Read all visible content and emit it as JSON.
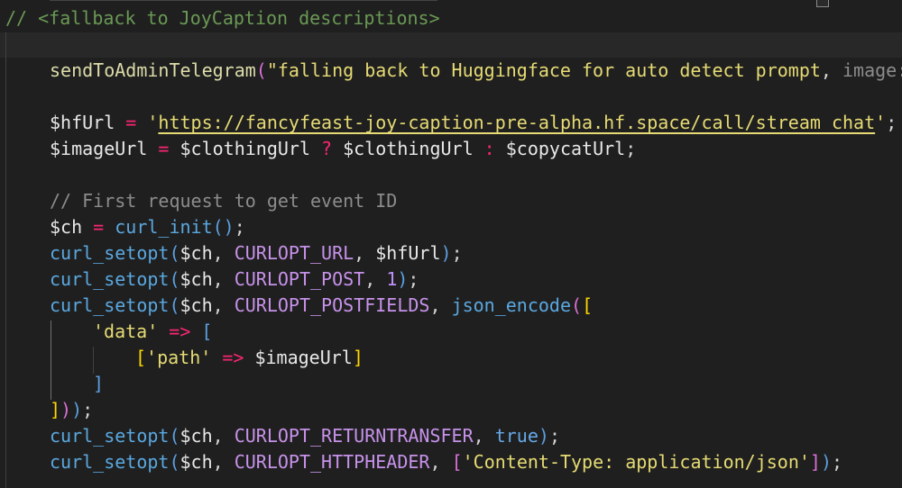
{
  "editor": {
    "language": "php",
    "theme_colors": {
      "background": "#1f1f1f",
      "current_line": "#282828",
      "comment": "#6a9955",
      "function": "#dcdcaa",
      "string": "#e6db74",
      "variable": "#e8e8e8",
      "operator": "#f92672",
      "constant": "#c792ea"
    },
    "lines": [
      {
        "tokens": [
          {
            "t": "// <fallback to JoyCaption descriptions>",
            "c": "c-com"
          }
        ]
      },
      {
        "tokens": []
      },
      {
        "tokens": [
          {
            "t": "sendToAdminTelegram",
            "c": "c-fn"
          },
          {
            "t": "(",
            "c": "c-b2"
          },
          {
            "t": "\"falling back to Huggingface for auto detect prompt",
            "c": "c-str2"
          },
          {
            "t": ", ",
            "c": "c-pun"
          },
          {
            "t": "image: ",
            "c": "c-hint"
          },
          {
            "t": "\"",
            "c": "c-str2"
          }
        ]
      },
      {
        "tokens": []
      },
      {
        "tokens": [
          {
            "t": "$hfUrl",
            "c": "c-var"
          },
          {
            "t": " = ",
            "c": "c-op"
          },
          {
            "t": "'",
            "c": "c-str2"
          },
          {
            "t": "https://fancyfeast-joy-caption-pre-alpha.hf.space/call/stream_chat",
            "c": "c-url"
          },
          {
            "t": "'",
            "c": "c-str2"
          },
          {
            "t": ";",
            "c": "c-pun"
          }
        ]
      },
      {
        "tokens": [
          {
            "t": "$imageUrl",
            "c": "c-var"
          },
          {
            "t": " = ",
            "c": "c-op"
          },
          {
            "t": "$clothingUrl",
            "c": "c-var"
          },
          {
            "t": " ? ",
            "c": "c-op"
          },
          {
            "t": "$clothingUrl",
            "c": "c-var"
          },
          {
            "t": " : ",
            "c": "c-op"
          },
          {
            "t": "$copycatUrl",
            "c": "c-var"
          },
          {
            "t": ";",
            "c": "c-pun"
          }
        ]
      },
      {
        "tokens": []
      },
      {
        "tokens": [
          {
            "t": "// First request to get event ID",
            "c": "c-hint"
          }
        ]
      },
      {
        "tokens": [
          {
            "t": "$ch",
            "c": "c-var"
          },
          {
            "t": " = ",
            "c": "c-op"
          },
          {
            "t": "curl_init",
            "c": "c-fn3"
          },
          {
            "t": "()",
            "c": "c-b1"
          },
          {
            "t": ";",
            "c": "c-pun"
          }
        ]
      },
      {
        "tokens": [
          {
            "t": "curl_setopt",
            "c": "c-fn3"
          },
          {
            "t": "(",
            "c": "c-b1"
          },
          {
            "t": "$ch",
            "c": "c-var"
          },
          {
            "t": ", ",
            "c": "c-pun"
          },
          {
            "t": "CURLOPT_URL",
            "c": "c-const"
          },
          {
            "t": ", ",
            "c": "c-pun"
          },
          {
            "t": "$hfUrl",
            "c": "c-var"
          },
          {
            "t": ")",
            "c": "c-b1"
          },
          {
            "t": ";",
            "c": "c-pun"
          }
        ]
      },
      {
        "tokens": [
          {
            "t": "curl_setopt",
            "c": "c-fn3"
          },
          {
            "t": "(",
            "c": "c-b1"
          },
          {
            "t": "$ch",
            "c": "c-var"
          },
          {
            "t": ", ",
            "c": "c-pun"
          },
          {
            "t": "CURLOPT_POST",
            "c": "c-const"
          },
          {
            "t": ", ",
            "c": "c-pun"
          },
          {
            "t": "1",
            "c": "c-num"
          },
          {
            "t": ")",
            "c": "c-b1"
          },
          {
            "t": ";",
            "c": "c-pun"
          }
        ]
      },
      {
        "tokens": [
          {
            "t": "curl_setopt",
            "c": "c-fn3"
          },
          {
            "t": "(",
            "c": "c-b1"
          },
          {
            "t": "$ch",
            "c": "c-var"
          },
          {
            "t": ", ",
            "c": "c-pun"
          },
          {
            "t": "CURLOPT_POSTFIELDS",
            "c": "c-const"
          },
          {
            "t": ", ",
            "c": "c-pun"
          },
          {
            "t": "json_encode",
            "c": "c-fn3"
          },
          {
            "t": "(",
            "c": "c-b2"
          },
          {
            "t": "[",
            "c": "c-b3"
          }
        ]
      },
      {
        "tokens": [
          {
            "t": "'data'",
            "c": "c-str2"
          },
          {
            "t": " => ",
            "c": "c-op"
          },
          {
            "t": "[",
            "c": "c-b1"
          }
        ]
      },
      {
        "tokens": [
          {
            "t": "[",
            "c": "c-b3"
          },
          {
            "t": "'path'",
            "c": "c-str2"
          },
          {
            "t": " => ",
            "c": "c-op"
          },
          {
            "t": "$imageUrl",
            "c": "c-var"
          },
          {
            "t": "]",
            "c": "c-b3"
          }
        ]
      },
      {
        "tokens": [
          {
            "t": "]",
            "c": "c-b1"
          }
        ]
      },
      {
        "tokens": [
          {
            "t": "]",
            "c": "c-b3"
          },
          {
            "t": ")",
            "c": "c-b2"
          },
          {
            "t": ")",
            "c": "c-b1"
          },
          {
            "t": ";",
            "c": "c-pun"
          }
        ]
      },
      {
        "tokens": [
          {
            "t": "curl_setopt",
            "c": "c-fn3"
          },
          {
            "t": "(",
            "c": "c-b1"
          },
          {
            "t": "$ch",
            "c": "c-var"
          },
          {
            "t": ", ",
            "c": "c-pun"
          },
          {
            "t": "CURLOPT_RETURNTRANSFER",
            "c": "c-const"
          },
          {
            "t": ", ",
            "c": "c-pun"
          },
          {
            "t": "true",
            "c": "c-kw"
          },
          {
            "t": ")",
            "c": "c-b1"
          },
          {
            "t": ";",
            "c": "c-pun"
          }
        ]
      },
      {
        "tokens": [
          {
            "t": "curl_setopt",
            "c": "c-fn3"
          },
          {
            "t": "(",
            "c": "c-b1"
          },
          {
            "t": "$ch",
            "c": "c-var"
          },
          {
            "t": ", ",
            "c": "c-pun"
          },
          {
            "t": "CURLOPT_HTTPHEADER",
            "c": "c-const"
          },
          {
            "t": ", ",
            "c": "c-pun"
          },
          {
            "t": "[",
            "c": "c-b2"
          },
          {
            "t": "'Content-Type: application/json'",
            "c": "c-str2"
          },
          {
            "t": "]",
            "c": "c-b2"
          },
          {
            "t": ")",
            "c": "c-b1"
          },
          {
            "t": ";",
            "c": "c-pun"
          }
        ]
      }
    ]
  }
}
